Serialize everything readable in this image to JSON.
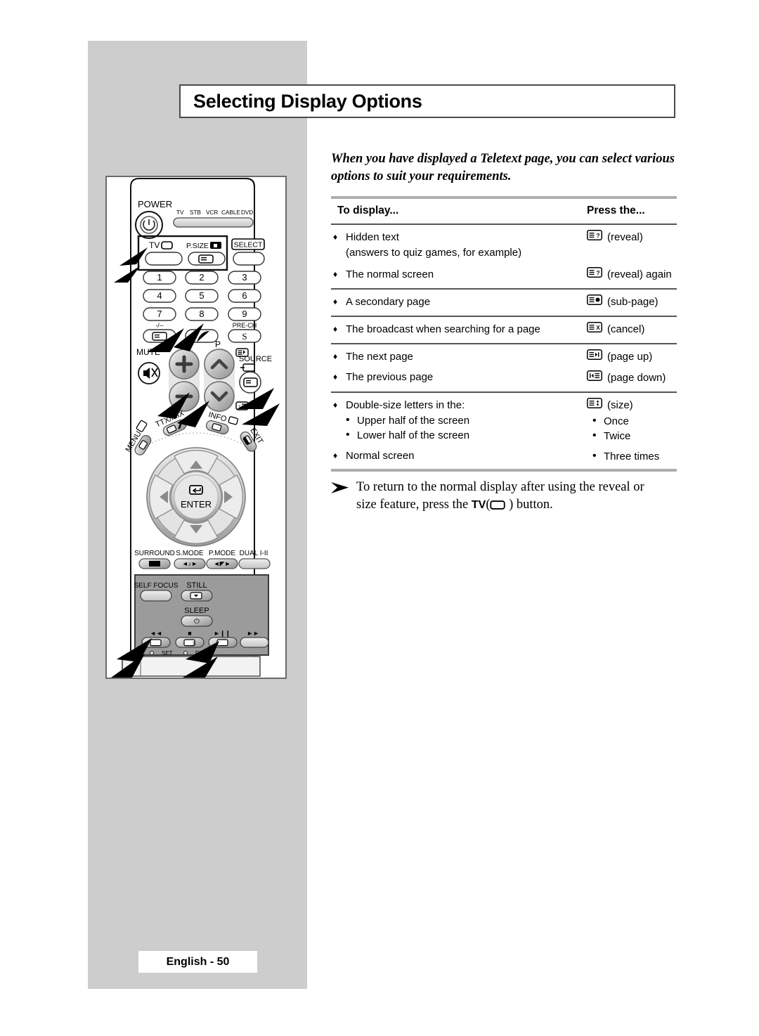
{
  "page": {
    "title": "Selecting Display Options",
    "intro": "When you have displayed a Teletext page, you can select various options to suit your requirements.",
    "footer_badge": "English - 50"
  },
  "table": {
    "header": {
      "col_a": "To display...",
      "col_b": "Press the..."
    },
    "rows": [
      {
        "items": [
          {
            "marker": "♦",
            "text": "Hidden text",
            "note": "(answers to quiz games, for example)"
          },
          {
            "marker": "♦",
            "text": "The normal screen"
          }
        ],
        "press": [
          {
            "icon": "teletext-reveal-icon",
            "label": "(reveal)"
          },
          {
            "icon": "teletext-reveal-icon",
            "label": "(reveal) again"
          }
        ]
      },
      {
        "items": [
          {
            "marker": "♦",
            "text": "A secondary page"
          }
        ],
        "press": [
          {
            "icon": "teletext-subpage-icon",
            "label": "(sub-page)"
          }
        ]
      },
      {
        "items": [
          {
            "marker": "♦",
            "text": "The broadcast when searching for a page"
          }
        ],
        "press": [
          {
            "icon": "teletext-cancel-icon",
            "label": "(cancel)"
          }
        ]
      },
      {
        "items": [
          {
            "marker": "♦",
            "text": "The next page"
          },
          {
            "marker": "♦",
            "text": "The previous page"
          }
        ],
        "press": [
          {
            "icon": "teletext-page-up-icon",
            "label": "(page up)"
          },
          {
            "icon": "teletext-page-down-icon",
            "label": "(page down)"
          }
        ]
      },
      {
        "items": [
          {
            "marker": "♦",
            "text": "Double-size letters in the:"
          },
          {
            "marker": "•",
            "text": "Upper half of the screen"
          },
          {
            "marker": "•",
            "text": "Lower half of the screen"
          },
          {
            "marker": "♦",
            "text": "Normal screen"
          }
        ],
        "press": [
          {
            "icon": "teletext-size-icon",
            "label": "(size)"
          },
          {
            "marker": "•",
            "label": "Once"
          },
          {
            "marker": "•",
            "label": "Twice"
          },
          {
            "marker": "•",
            "label": "Three times"
          }
        ]
      }
    ]
  },
  "note": {
    "arrow": "arrow-right-icon",
    "line1": "To return to the normal display after using the reveal or",
    "line2_before": "size feature, press the ",
    "line2_tv": "TV",
    "line2_after": " ) button.",
    "line2_paren": "("
  },
  "remote": {
    "labels": {
      "power": "POWER",
      "devices": [
        "TV",
        "STB",
        "VCR",
        "CABLE",
        "DVD"
      ],
      "tv": "TV",
      "psize": "P.SIZE",
      "select": "SELECT",
      "keys": [
        "1",
        "2",
        "3",
        "4",
        "5",
        "6",
        "7",
        "8",
        "9"
      ],
      "dash": "-/--",
      "prech": "PRE-CH",
      "mute": "MUTE",
      "p": "P",
      "source": "SOURCE",
      "ttx": "TTX/MIX",
      "info": "INFO",
      "menu": "MENU",
      "exit": "EXIT",
      "enter": "ENTER",
      "surround": "SURROUND",
      "smode": "S.MODE",
      "pmode": "P.MODE",
      "dual": "DUAL I-II",
      "selffocus": "SELF FOCUS",
      "still": "STILL",
      "sleep": "SLEEP",
      "rew": "◄◄",
      "stop": "■",
      "playpause": "►❙❙",
      "ff": "►►",
      "set": "SET",
      "reset": "RESET"
    }
  },
  "colors": {
    "panel_gray": "#cdcdcd",
    "rule_light": "#aeaeae",
    "rule_dark": "#555555",
    "border": "#4a4a4a",
    "text": "#000000"
  }
}
